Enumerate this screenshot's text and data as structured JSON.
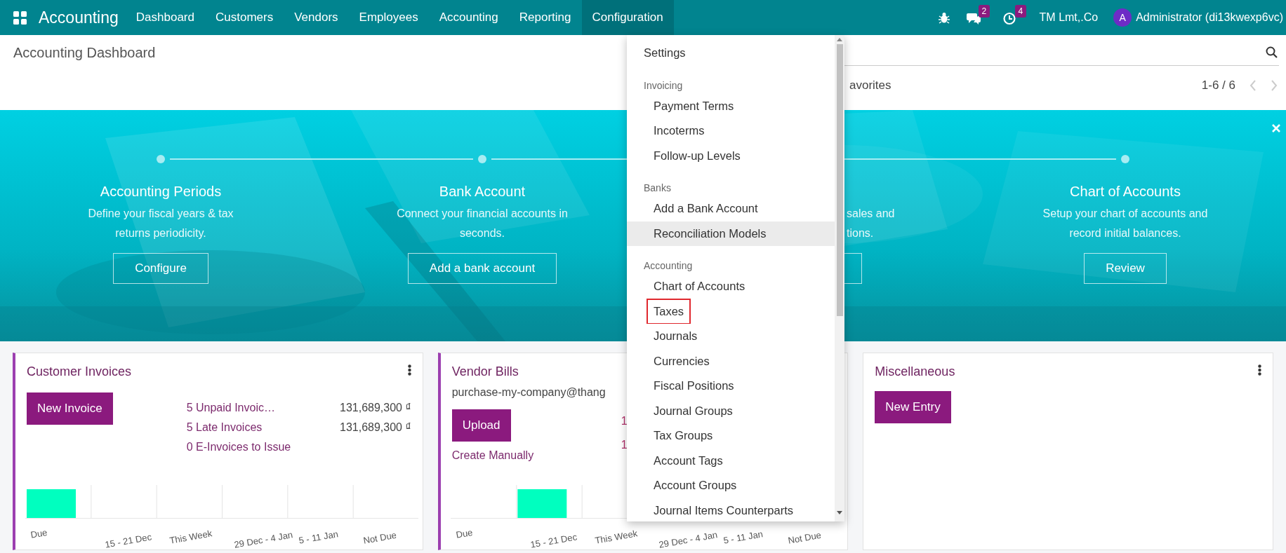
{
  "navbar": {
    "app_name": "Accounting",
    "menu": [
      {
        "label": "Dashboard",
        "selected": false
      },
      {
        "label": "Customers",
        "selected": false
      },
      {
        "label": "Vendors",
        "selected": false
      },
      {
        "label": "Employees",
        "selected": false
      },
      {
        "label": "Accounting",
        "selected": false
      },
      {
        "label": "Reporting",
        "selected": false
      },
      {
        "label": "Configuration",
        "selected": true
      }
    ],
    "chat_count": "2",
    "activity_count": "4",
    "company": "TM Lmt,.Co",
    "user": {
      "initial": "A",
      "name": "Administrator (di13kwexp6vc)"
    }
  },
  "control_panel": {
    "title": "Accounting Dashboard",
    "filter_label": "avorites",
    "pager": "1-6 / 6"
  },
  "onboarding": {
    "steps": [
      {
        "kind": "full",
        "title": "Accounting Periods",
        "description": "Define your fiscal years & tax\nreturns periodicity.",
        "button": "Configure"
      },
      {
        "kind": "full",
        "title": "Bank Account",
        "description": "Connect your financial accounts in\nseconds.",
        "button": "Add a bank account"
      },
      {
        "kind": "covered",
        "description": "sales and\ntions."
      },
      {
        "kind": "full",
        "title": "Chart of Accounts",
        "description": "Setup your chart of accounts and\nrecord initial balances.",
        "button": "Review"
      }
    ]
  },
  "cards": [
    {
      "kind": "sales",
      "title": "Customer Invoices",
      "button": "New Invoice",
      "stats": [
        {
          "label": "5 Unpaid Invoic…",
          "amount": "131,689,300 ₫"
        },
        {
          "label": "5 Late Invoices",
          "amount": "131,689,300 ₫"
        },
        {
          "label": "0 E-Invoices to Issue"
        }
      ],
      "chart_columns": [
        {
          "label": "Due",
          "filled": true
        },
        {
          "label": "15 - 21 Dec",
          "filled": false
        },
        {
          "label": "This Week",
          "filled": false
        },
        {
          "label": "29 Dec - 4 Jan",
          "filled": false
        },
        {
          "label": "5 - 11 Jan",
          "filled": false
        },
        {
          "label": "Not Due",
          "filled": false
        }
      ]
    },
    {
      "kind": "purchase",
      "title": "Vendor Bills",
      "email": "purchase-my-company@thang",
      "button": "Upload",
      "link": "Create Manually",
      "stats": [
        {
          "label": "1"
        },
        {
          "label": "1"
        }
      ],
      "chart_columns": [
        {
          "label": "Due",
          "filled": false
        },
        {
          "label": "15 - 21 Dec",
          "filled": true
        },
        {
          "label": "This Week",
          "filled": false
        },
        {
          "label": "29 Dec - 4 Jan",
          "filled": false
        },
        {
          "label": "5 - 11 Jan",
          "filled": false
        },
        {
          "label": "Not Due",
          "filled": false
        }
      ]
    },
    {
      "kind": "general",
      "title": "Miscellaneous",
      "button": "New Entry"
    }
  ],
  "dropdown": {
    "items": [
      {
        "kind": "item",
        "label": "Settings",
        "top": true,
        "hovered": false,
        "highlighted": false
      },
      {
        "kind": "header",
        "label": "Invoicing"
      },
      {
        "kind": "item",
        "label": "Payment Terms",
        "hovered": false,
        "highlighted": false
      },
      {
        "kind": "item",
        "label": "Incoterms",
        "hovered": false,
        "highlighted": false
      },
      {
        "kind": "item",
        "label": "Follow-up Levels",
        "hovered": false,
        "highlighted": false
      },
      {
        "kind": "header",
        "label": "Banks"
      },
      {
        "kind": "item",
        "label": "Add a Bank Account",
        "hovered": false,
        "highlighted": false
      },
      {
        "kind": "item",
        "label": "Reconciliation Models",
        "hovered": true,
        "highlighted": false
      },
      {
        "kind": "header",
        "label": "Accounting"
      },
      {
        "kind": "item",
        "label": "Chart of Accounts",
        "hovered": false,
        "highlighted": false
      },
      {
        "kind": "item",
        "label": "Taxes",
        "hovered": false,
        "highlighted": true
      },
      {
        "kind": "item",
        "label": "Journals",
        "hovered": false,
        "highlighted": false
      },
      {
        "kind": "item",
        "label": "Currencies",
        "hovered": false,
        "highlighted": false
      },
      {
        "kind": "item",
        "label": "Fiscal Positions",
        "hovered": false,
        "highlighted": false
      },
      {
        "kind": "item",
        "label": "Journal Groups",
        "hovered": false,
        "highlighted": false
      },
      {
        "kind": "item",
        "label": "Tax Groups",
        "hovered": false,
        "highlighted": false
      },
      {
        "kind": "item",
        "label": "Account Tags",
        "hovered": false,
        "highlighted": false
      },
      {
        "kind": "item",
        "label": "Account Groups",
        "hovered": false,
        "highlighted": false
      },
      {
        "kind": "item",
        "label": "Journal Items Counterparts",
        "hovered": false,
        "highlighted": false
      }
    ]
  }
}
